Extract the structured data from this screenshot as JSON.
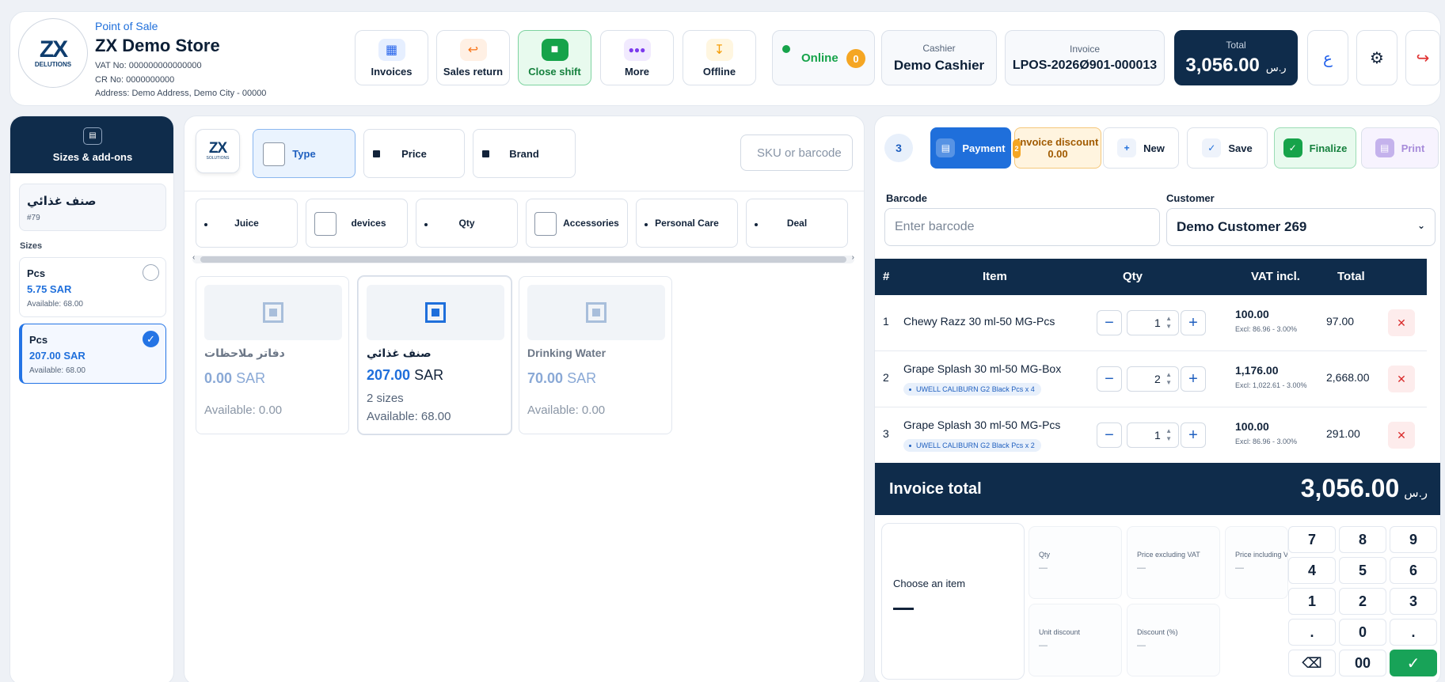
{
  "header": {
    "subtitle": "Point of Sale",
    "store_name": "ZX Demo Store",
    "vat_no": "VAT No: 000000000000000",
    "cr_no": "CR No: 0000000000",
    "address": "Address: Demo Address, Demo City - 00000",
    "logo_mark": "ZX",
    "logo_sub": "DELUTIONS",
    "toolbar": [
      {
        "label": "Invoices",
        "icon": "invoices-icon",
        "color": "#2563eb"
      },
      {
        "label": "Sales return",
        "icon": "return-icon",
        "color": "#f97316"
      },
      {
        "label": "Close shift",
        "icon": "close-shift-icon",
        "color": "#16a34a"
      },
      {
        "label": "More",
        "icon": "more-icon",
        "color": "#7c3aed"
      },
      {
        "label": "Offline",
        "icon": "offline-icon",
        "color": "#f59e0b"
      }
    ],
    "online_label": "Online",
    "online_count": "0",
    "cashier_label": "Cashier",
    "cashier_value": "Demo Cashier",
    "invoice_label": "Invoice",
    "invoice_value": "LPOS-2026Ø901-000013",
    "total_label": "Total",
    "total_value": "3,056.00",
    "currency": "ر.س",
    "lang_glyph": "ع"
  },
  "left_panel": {
    "title": "Sizes & add-ons",
    "selected_item_name": "صنف غذائي",
    "selected_item_id": "#79",
    "sizes_label": "Sizes",
    "sizes": [
      {
        "name": "Pcs",
        "price": "5.75 SAR",
        "available": "Available: 68.00",
        "selected": false
      },
      {
        "name": "Pcs",
        "price": "207.00 SAR",
        "available": "Available: 68.00",
        "selected": true
      }
    ]
  },
  "middle": {
    "logo_mark": "ZX",
    "logo_sub": "SOLUTIONS",
    "filter_tabs": [
      "Type",
      "Price",
      "Brand"
    ],
    "search_placeholder": "SKU or barcode",
    "categories": [
      "Juice",
      "devices",
      "Qty",
      "Accessories",
      "Personal Care",
      "Deal"
    ],
    "products": [
      {
        "name": "دفاتر ملاحظات",
        "price": "0.00",
        "currency": "SAR",
        "extra": "",
        "available": "Available: 0.00"
      },
      {
        "name": "صنف غذائي",
        "price": "207.00",
        "currency": "SAR",
        "extra": "2 sizes",
        "available": "Available: 68.00"
      },
      {
        "name": "Drinking Water",
        "price": "70.00",
        "currency": "SAR",
        "extra": "",
        "available": "Available: 0.00"
      }
    ]
  },
  "right": {
    "count_badge": "3",
    "actions": {
      "payment": "Payment",
      "discount_label": "Invoice discount",
      "discount_value": "0.00",
      "discount_badge": "2",
      "new": "New",
      "save": "Save",
      "finalize": "Finalize",
      "print": "Print"
    },
    "barcode_label": "Barcode",
    "barcode_placeholder": "Enter barcode",
    "customer_label": "Customer",
    "customer_value": "Demo Customer 269",
    "table_headers": {
      "num": "#",
      "item": "Item",
      "qty": "Qty",
      "vat": "VAT incl.",
      "total": "Total"
    },
    "rows": [
      {
        "num": "1",
        "name": "Chewy Razz 30 ml-50 MG-Pcs",
        "tag": "",
        "qty": "1",
        "vat_incl": "100.00",
        "excl": "Excl: 86.96 - 3.00%",
        "total": "97.00"
      },
      {
        "num": "2",
        "name": "Grape Splash 30 ml-50 MG-Box",
        "tag": "UWELL CALIBURN G2 Black Pcs x 4",
        "qty": "2",
        "vat_incl": "1,176.00",
        "excl": "Excl: 1,022.61 - 3.00%",
        "total": "2,668.00"
      },
      {
        "num": "3",
        "name": "Grape Splash 30 ml-50 MG-Pcs",
        "tag": "UWELL CALIBURN G2 Black Pcs x 2",
        "qty": "1",
        "vat_incl": "100.00",
        "excl": "Excl: 86.96 - 3.00%",
        "total": "291.00"
      }
    ],
    "invoice_total_label": "Invoice total",
    "invoice_total_value": "3,056.00",
    "choose_item": "Choose an item",
    "mini_fields": [
      {
        "label": "Qty",
        "value": "—"
      },
      {
        "label": "Price excluding VAT",
        "value": "—"
      },
      {
        "label": "Price including VAT",
        "value": "—"
      },
      {
        "label": "Unit discount",
        "value": "—"
      },
      {
        "label": "Discount (%)",
        "value": "—"
      }
    ],
    "keypad": [
      "7",
      "8",
      "9",
      "4",
      "5",
      "6",
      "1",
      "2",
      "3",
      ".",
      "0",
      ".",
      "⌫",
      "00",
      "✓"
    ]
  }
}
